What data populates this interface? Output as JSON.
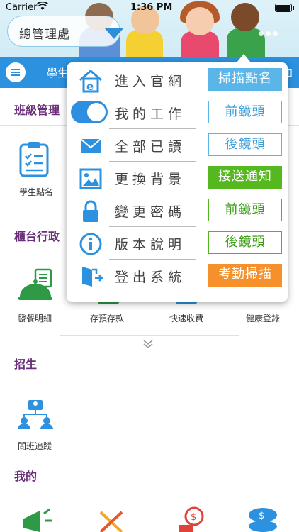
{
  "status_bar": {
    "carrier": "Carrier",
    "time": "1:36 PM"
  },
  "header": {
    "title": "總管理處"
  },
  "navbar": {
    "left_text": "學生",
    "right_text": "知"
  },
  "sections": [
    {
      "title": "班級管理",
      "tiles": [
        {
          "label": "學生點名",
          "icon": "clipboard-checklist-icon"
        }
      ]
    },
    {
      "title": "櫃台行政",
      "tiles": [
        {
          "label": "發餐明細",
          "icon": "food-cloche-icon"
        },
        {
          "label": "存預存款",
          "icon": "deposit-icon"
        },
        {
          "label": "快速收費",
          "icon": "fast-payment-icon"
        },
        {
          "label": "健康登錄",
          "icon": "health-record-icon"
        }
      ]
    },
    {
      "title": "招生",
      "tiles": [
        {
          "label": "問班追蹤",
          "icon": "class-tracking-icon"
        }
      ]
    },
    {
      "title": "我的",
      "tiles": []
    }
  ],
  "popup_menu": {
    "items": [
      {
        "label": "進入官網",
        "icon": "browser-home-icon"
      },
      {
        "label": "我的工作",
        "icon": "toggle-switch-icon"
      },
      {
        "label": "全部已讀",
        "icon": "envelope-icon"
      },
      {
        "label": "更換背景",
        "icon": "picture-icon"
      },
      {
        "label": "變更密碼",
        "icon": "lock-icon"
      },
      {
        "label": "版本說明",
        "icon": "info-icon"
      },
      {
        "label": "登出系統",
        "icon": "logout-door-icon"
      }
    ],
    "actions": [
      {
        "label": "掃描點名",
        "style": "blue"
      },
      {
        "label": "前鏡頭",
        "style": "outline-blue"
      },
      {
        "label": "後鏡頭",
        "style": "outline-blue"
      },
      {
        "label": "接送通知",
        "style": "green"
      },
      {
        "label": "前鏡頭",
        "style": "outline-green"
      },
      {
        "label": "後鏡頭",
        "style": "outline-green"
      },
      {
        "label": "考勤掃描",
        "style": "orange"
      }
    ]
  },
  "colors": {
    "accent": "#2c92e0",
    "section_title": "#6b2f7a",
    "green": "#56b81f",
    "orange": "#f5902a"
  }
}
